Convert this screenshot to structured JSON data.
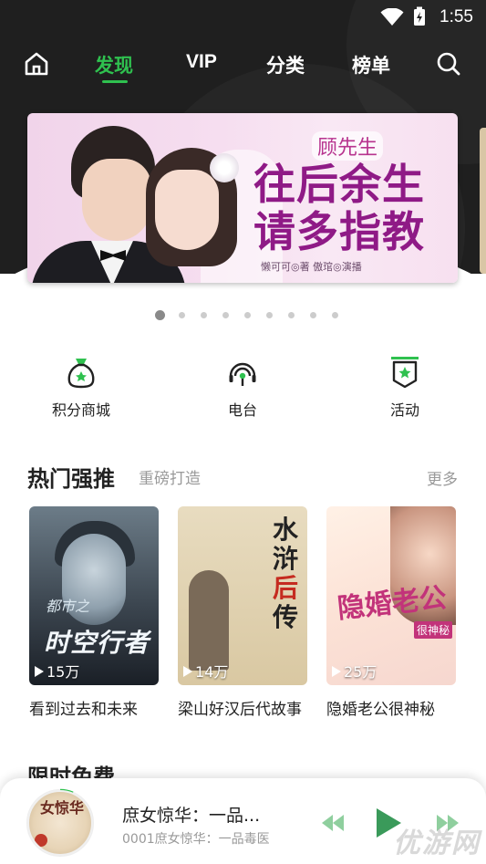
{
  "status_bar": {
    "time": "1:55"
  },
  "top_nav": {
    "tabs": [
      {
        "label": "发现",
        "active": true
      },
      {
        "label": "VIP",
        "active": false
      },
      {
        "label": "分类",
        "active": false
      },
      {
        "label": "榜单",
        "active": false
      }
    ],
    "icons": [
      "home-icon",
      "search-icon"
    ]
  },
  "banner": {
    "small_title": "顾先生",
    "big_title": "往后余生 请多指教",
    "credit": "懒可可◎著  傲琯◎演播",
    "page_count": 9,
    "active_index": 0
  },
  "shortcuts": [
    {
      "label": "积分商城",
      "icon": "money-bag-icon"
    },
    {
      "label": "电台",
      "icon": "radio-headphones-icon"
    },
    {
      "label": "活动",
      "icon": "activity-badge-icon"
    }
  ],
  "hot_section": {
    "title": "热门强推",
    "subtitle": "重磅打造",
    "more": "更多",
    "books": [
      {
        "title": "看到过去和未来",
        "plays": "15万",
        "cover_text_top": "都市之",
        "cover_text_main": "时空行者"
      },
      {
        "title": "梁山好汉后代故事",
        "plays": "14万",
        "cover_text_main": "水浒后传"
      },
      {
        "title": "隐婚老公很神秘",
        "plays": "25万",
        "cover_text_main": "隐婚老公",
        "cover_tag": "很神秘"
      }
    ]
  },
  "free_section": {
    "title": "限时免费"
  },
  "player": {
    "title": "庶女惊华：一品...",
    "subtitle": "0001庶女惊华：一品毒医",
    "art_text": "女惊华"
  },
  "watermark": "优游网",
  "colors": {
    "accent": "#2fc14f",
    "header_bg": "#1f1f1f"
  }
}
